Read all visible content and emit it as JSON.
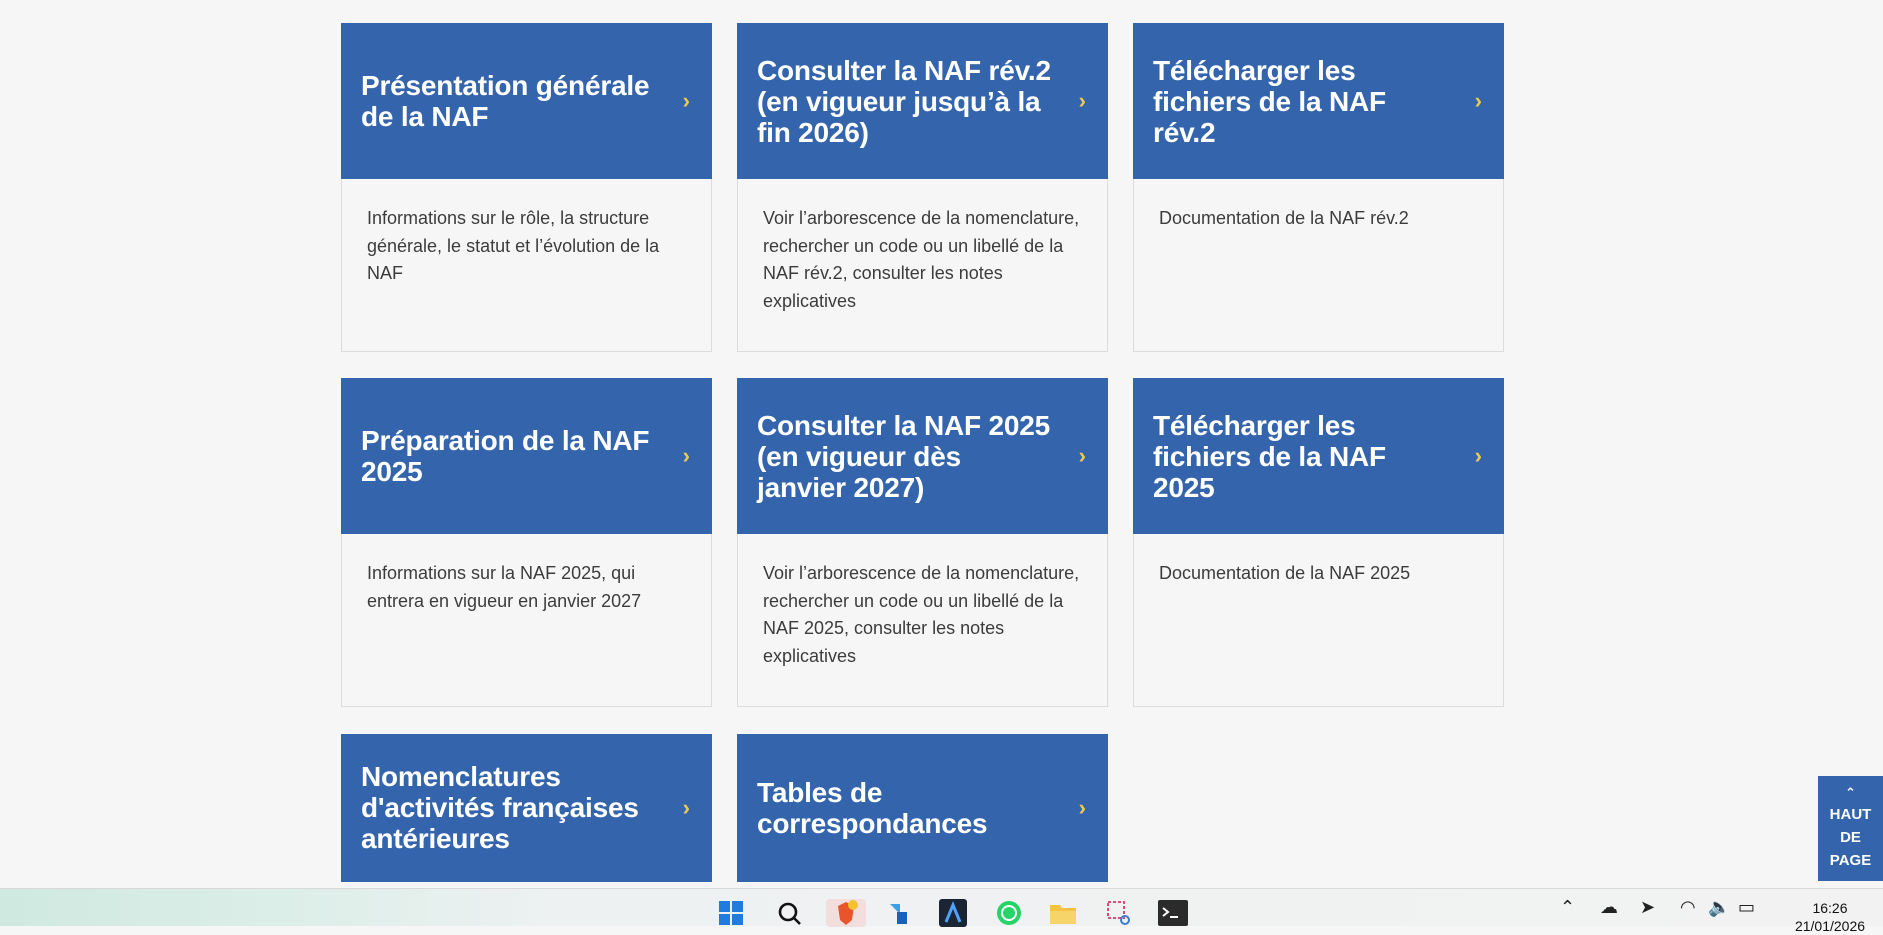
{
  "cards": [
    {
      "title": "Présentation générale de la NAF",
      "description": "Informations sur le rôle, la structure générale, le statut et l’évolution de la NAF"
    },
    {
      "title": "Consulter la NAF rév.2 (en vigueur jusqu’à la fin 2026)",
      "description": "Voir l’arborescence de la nomenclature, rechercher un code ou un libellé de la NAF rév.2, consulter les notes explicatives"
    },
    {
      "title": "Télécharger les fichiers de la NAF rév.2",
      "description": "Documentation de la NAF rév.2"
    },
    {
      "title": "Préparation de la NAF 2025",
      "description": "Informations sur la NAF 2025, qui entrera en vigueur en janvier 2027"
    },
    {
      "title": "Consulter la NAF 2025 (en vigueur dès janvier 2027)",
      "description": "Voir l’arborescence de la nomenclature, rechercher un code ou un libellé de la NAF 2025, consulter les notes explicatives"
    },
    {
      "title": "Télécharger les fichiers de la NAF 2025",
      "description": "Documentation de la NAF 2025"
    },
    {
      "title": "Nomenclatures d'activités françaises antérieures"
    },
    {
      "title": "Tables de correspondances"
    }
  ],
  "chevron": "›",
  "back_to_top": {
    "caret": "⌃",
    "line1": "HAUT",
    "line2": "DE",
    "line3": "PAGE"
  },
  "taskbar": {
    "icons": [
      "windows-start-icon",
      "search-icon",
      "brave-browser-icon",
      "app-icon",
      "arc-icon",
      "whatsapp-icon",
      "file-explorer-icon",
      "snipping-tool-icon",
      "terminal-icon"
    ],
    "tray": [
      "chevron-up-icon",
      "onedrive-icon",
      "location-icon",
      "wifi-icon",
      "volume-icon",
      "battery-icon"
    ],
    "time": "16:26",
    "date": "21/01/2026"
  },
  "colors": {
    "card_header": "#3465ac",
    "chevron": "#f2c94c",
    "background": "#f6f6f6"
  }
}
